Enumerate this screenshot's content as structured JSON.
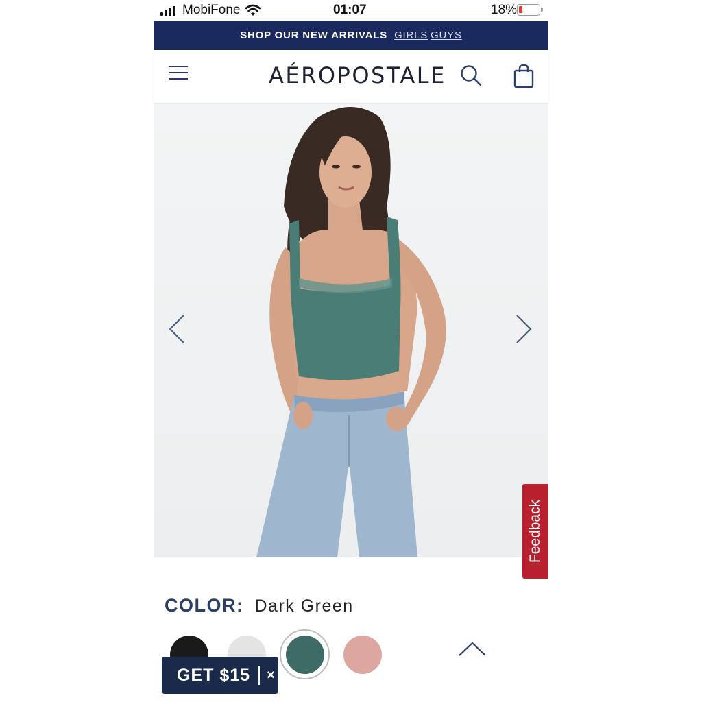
{
  "status_bar": {
    "carrier": "MobiFone",
    "time": "01:07",
    "battery": "18%",
    "battery_level": 0.18
  },
  "promo": {
    "text": "SHOP OUR NEW ARRIVALS",
    "links": [
      "GIRLS",
      "GUYS"
    ]
  },
  "header": {
    "logo": "AÉROPOSTALE",
    "icons": [
      "menu-icon",
      "search-icon",
      "shopping-bag-icon"
    ]
  },
  "product": {
    "image_alt": "model wearing dark green lace-trim crop tank and light wash jeans",
    "prev_icon": "chevron-left-icon",
    "next_icon": "chevron-right-icon"
  },
  "feedback": {
    "label": "Feedback"
  },
  "color": {
    "label": "COLOR:",
    "value": "Dark Green",
    "swatches": [
      {
        "name": "black",
        "hex": "#1a1a1a",
        "selected": false
      },
      {
        "name": "white",
        "hex": "#e4e4e4",
        "selected": false
      },
      {
        "name": "dark green",
        "hex": "#3f6b66",
        "selected": true
      },
      {
        "name": "pink",
        "hex": "#dba79f",
        "selected": false
      }
    ]
  },
  "promo_popup": {
    "label": "GET $15",
    "close": "×"
  },
  "colors": {
    "banner": "#1b2a5e",
    "accent": "#2b3f6b",
    "feedback": "#b8202d"
  }
}
